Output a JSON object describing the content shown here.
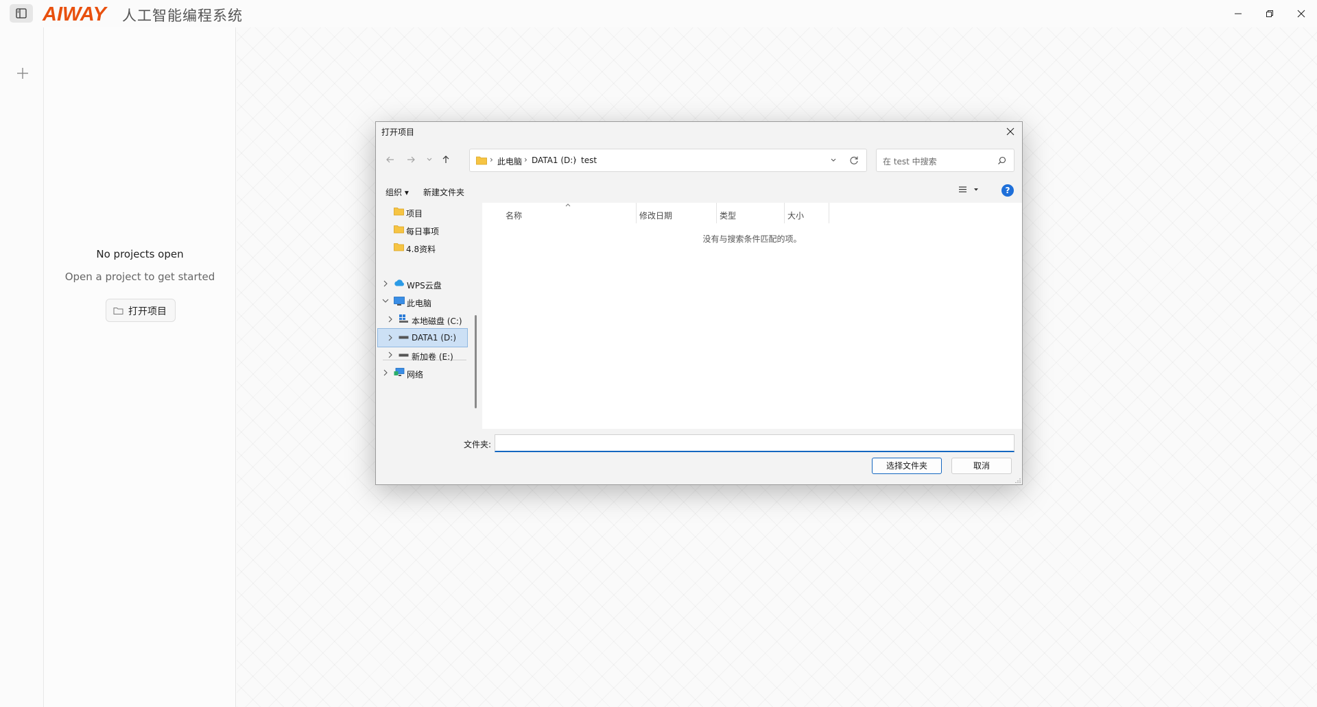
{
  "app": {
    "logo_text": "AIWAY",
    "title": "人工智能编程系统",
    "brand_color": "#e8500e"
  },
  "projects_panel": {
    "empty_title": "No projects open",
    "empty_subtitle": "Open a project to get started",
    "open_button": "打开项目"
  },
  "dialog": {
    "title": "打开项目",
    "breadcrumbs": [
      "此电脑",
      "DATA1 (D:)",
      "test"
    ],
    "breadcrumb_separator": "›",
    "search_placeholder": "在 test 中搜索",
    "toolbar": {
      "organize": "组织 ▾",
      "new_folder": "新建文件夹",
      "help": "?"
    },
    "nav_items": {
      "project": "项目",
      "daily": "每日事项",
      "materials": "4.8资料",
      "wps_cloud": "WPS云盘",
      "this_pc": "此电脑",
      "drive_c": "本地磁盘 (C:)",
      "drive_d": "DATA1 (D:)",
      "drive_e": "新加卷 (E:)",
      "network": "网络"
    },
    "columns": {
      "name": "名称",
      "modified": "修改日期",
      "type": "类型",
      "size": "大小"
    },
    "empty_message": "没有与搜索条件匹配的项。",
    "folder_label": "文件夹:",
    "folder_value": "",
    "select_button": "选择文件夹",
    "cancel_button": "取消",
    "accent_color": "#1366c0"
  }
}
